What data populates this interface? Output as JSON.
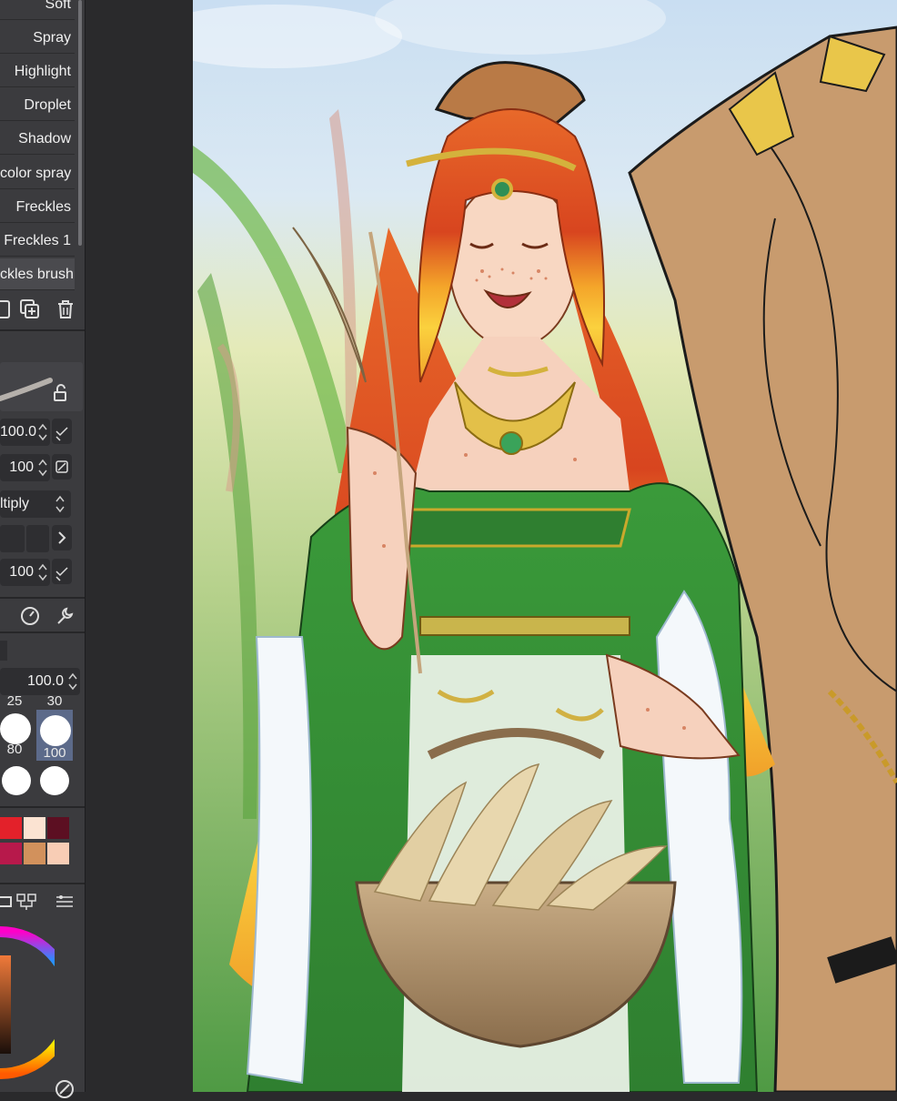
{
  "brushes": {
    "items": [
      {
        "label": "Soft"
      },
      {
        "label": "Spray"
      },
      {
        "label": "Highlight"
      },
      {
        "label": "Droplet"
      },
      {
        "label": "Shadow"
      },
      {
        "label": "color spray"
      },
      {
        "label": "Freckles"
      },
      {
        "label": "Freckles 1"
      },
      {
        "label": "ckles brush"
      }
    ]
  },
  "tool_properties": {
    "opacity_value": "100.0",
    "density_value": "100",
    "blend_mode": "ltiply",
    "stroke_value": "100",
    "global_value": "100.0"
  },
  "brush_sizes": {
    "items": [
      {
        "label": "25"
      },
      {
        "label": "30"
      },
      {
        "label": "80"
      },
      {
        "label": "100"
      }
    ],
    "selected": "100"
  },
  "color_palette": {
    "colors": [
      "#e3212a",
      "#fbe3d2",
      "#5c0f22",
      "#b7194b",
      "#d2915c",
      "#f8cdb5"
    ]
  },
  "colors": {
    "panel_bg": "#3b3b3e",
    "workspace_bg": "#2a2a2c",
    "accent_selected": "#5c6a8a"
  },
  "canvas": {
    "subject": "digital illustration of a red-haired freckled girl in a green gown holding a basket of pampas grass"
  }
}
